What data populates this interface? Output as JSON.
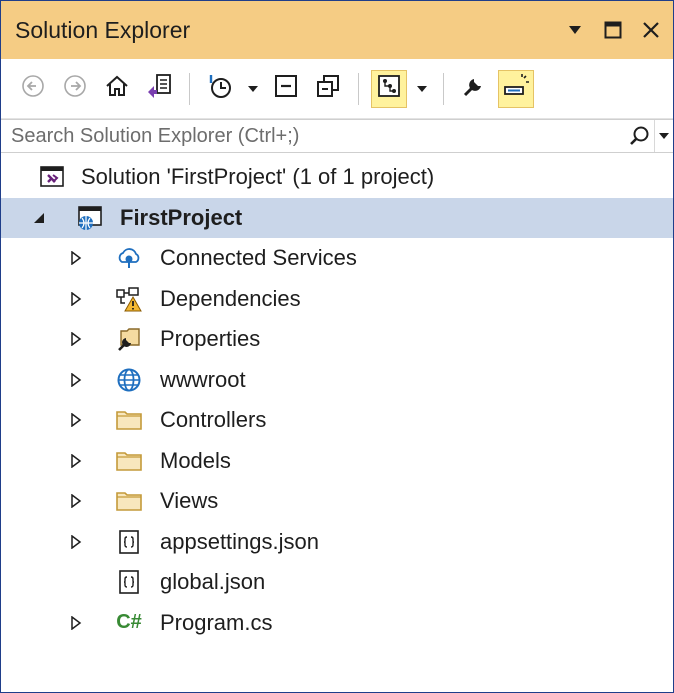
{
  "window": {
    "title": "Solution Explorer"
  },
  "search": {
    "placeholder": "Search Solution Explorer (Ctrl+;)"
  },
  "tree": {
    "solution": {
      "label": "Solution 'FirstProject' (1 of 1 project)"
    },
    "project": {
      "label": "FirstProject"
    },
    "items": [
      {
        "label": "Connected Services",
        "icon": "connected-services-icon"
      },
      {
        "label": "Dependencies",
        "icon": "dependencies-warning-icon"
      },
      {
        "label": "Properties",
        "icon": "properties-icon"
      },
      {
        "label": "wwwroot",
        "icon": "globe-icon"
      },
      {
        "label": "Controllers",
        "icon": "folder-icon"
      },
      {
        "label": "Models",
        "icon": "folder-icon"
      },
      {
        "label": "Views",
        "icon": "folder-icon"
      },
      {
        "label": "appsettings.json",
        "icon": "json-file-icon"
      },
      {
        "label": "global.json",
        "icon": "json-file-icon"
      },
      {
        "label": "Program.cs",
        "icon": "csharp-file-icon",
        "badge": "C#"
      }
    ]
  },
  "colors": {
    "title_bar": "#f5cc84",
    "selected_row": "#c9d6e9",
    "active_button": "#fff29d",
    "folder": "#dcb67a",
    "csharp": "#388a34",
    "accent_blue": "#1f6fbf"
  }
}
